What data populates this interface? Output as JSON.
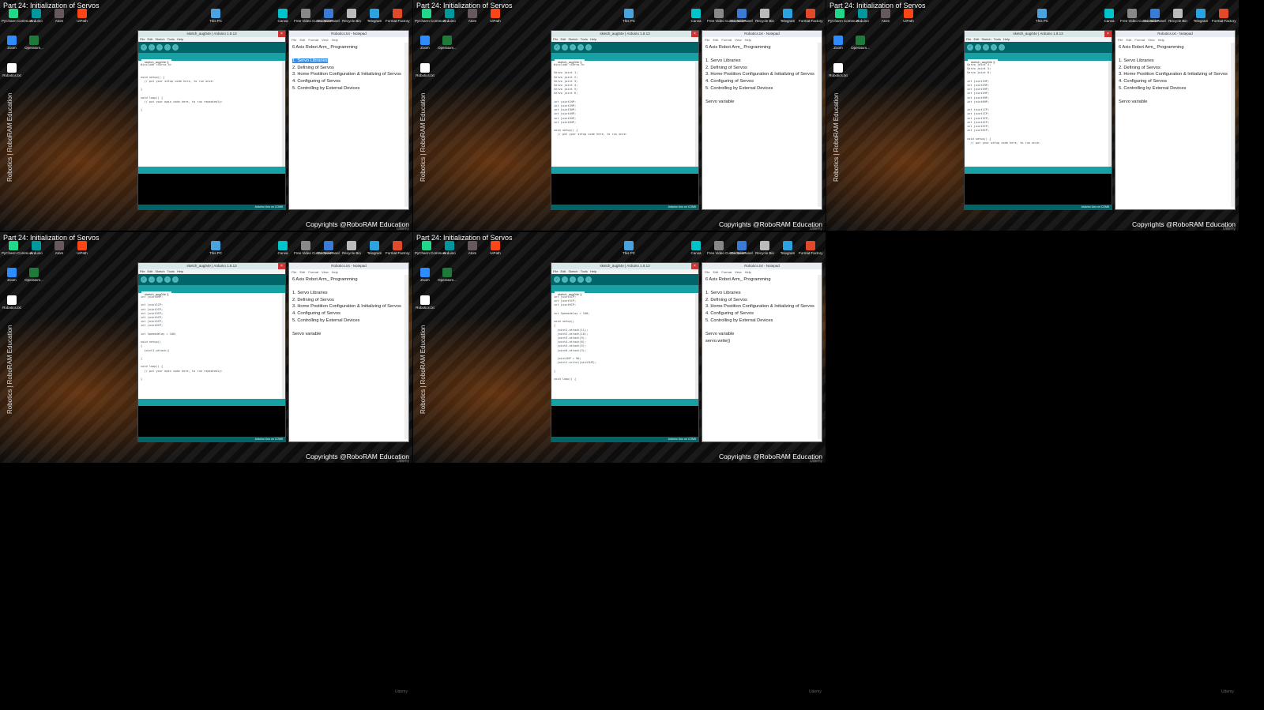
{
  "frame_title": "Part 24: Initialization of Servos",
  "watermark": "Robotics | RoboRAM Education",
  "copyright": "Copyrights @RoboRAM Education",
  "udemy": "Udemy",
  "desktop_top_icons": [
    {
      "label": "PyCharm Communi...",
      "color": "#21d789"
    },
    {
      "label": "Arduino",
      "color": "#00979d"
    },
    {
      "label": "Atom",
      "color": "#66595c"
    },
    {
      "label": "UiPath",
      "color": "#fa4616"
    }
  ],
  "desktop_mid_icons": [
    {
      "label": "This PC",
      "color": "#4aa3df"
    },
    {
      "label": "Canva",
      "color": "#00c4cc"
    },
    {
      "label": "Free Video Cutter Joiner",
      "color": "#888888"
    },
    {
      "label": "Control Panel",
      "color": "#3a7bd5"
    },
    {
      "label": "Recycle Bin",
      "color": "#bbbbbb"
    },
    {
      "label": "Telegram",
      "color": "#2aa3e0"
    },
    {
      "label": "Format Factory",
      "color": "#e04a2a"
    }
  ],
  "desktop_left_icons": [
    {
      "label": "Zoom",
      "color": "#2d8cff"
    },
    {
      "label": "Operators...",
      "color": "#1e7a3a"
    },
    {
      "label": "Robotics.txt",
      "color": "#ffffff"
    }
  ],
  "arduino": {
    "window_title": "sketch_aug04e | Arduino 1.8.13",
    "menu": [
      "File",
      "Edit",
      "Sketch",
      "Tools",
      "Help"
    ],
    "tab": "sketch_aug04e §",
    "status": "Arduino Uno on COM5"
  },
  "notepad": {
    "window_title": "Robotics.txt - Notepad",
    "menu": [
      "File",
      "Edit",
      "Format",
      "View",
      "Help"
    ],
    "heading": "6 Axis Robot Arm_ Programming",
    "items": [
      "1. Servo Libraries",
      "2. Defining of Servos",
      "3. Home Postition Configuration & Initializing of Servos",
      "4. Configuring of Servos",
      "5. Controlling by External Devices"
    ]
  },
  "frames": [
    {
      "code": "#include <Servo.h>\n\n\nvoid setup() {\n  // put your setup code here, to run once:\n\n}\n\nvoid loop() {\n  // put your main code here, to run repeatedly:\n\n}",
      "notes": []
    },
    {
      "code": "#include <Servo.h>\n\nServo joint 1;\nServo joint 2;\nServo joint 3;\nServo joint 4;\nServo joint 5;\nServo joint 6;\n\nint joint1HP;\nint joint2HP;\nint joint3HP;\nint joint4HP;\nint joint5HP;\nint joint6HP;\n\nvoid setup() {\n  // put your setup code here, to run once:",
      "notes": [
        "Servo variable"
      ]
    },
    {
      "code": "Servo joint 4;\nServo joint 5;\nServo joint 6;\n\nint joint1HP;\nint joint2HP;\nint joint3HP;\nint joint4HP;\nint joint5HP;\nint joint6HP;\n\nint joint1CP;\nint joint2CP;\nint joint3CP;\nint joint4CP;\nint joint5CP;\nint joint6CP;\n\nvoid setup() {\n  // put your setup code here, to run once:",
      "notes": [
        "Servo variable"
      ]
    },
    {
      "code": "int joint6HP;\n\nint joint1CP;\nint joint2CP;\nint joint3CP;\nint joint4CP;\nint joint5CP;\nint joint6CP;\n\nint Speeddelay = 100;\n\nvoid setup()\n{\n  joint1.attach()\n\n}\n\nvoid loop() {\n  // put your main code here, to run repeatedly:\n\n}",
      "notes": [
        "Servo variable"
      ]
    },
    {
      "code": "int joint4CP;\nint joint5CP;\nint joint6CP;\n\nint Speeddelay = 100;\n\nvoid setup()\n{\n  joint1.attach(11);\n  joint2.attach(10);\n  joint3.attach(9);\n  joint4.attach(6);\n  joint5.attach(5);\n  joint6.attach(3);\n\n  joint1HP = 90;\n  joint1.write(joint1HP);\n\n}\n\nvoid loop() {",
      "notes": [
        "Servo variable",
        "servo.write()"
      ]
    }
  ]
}
